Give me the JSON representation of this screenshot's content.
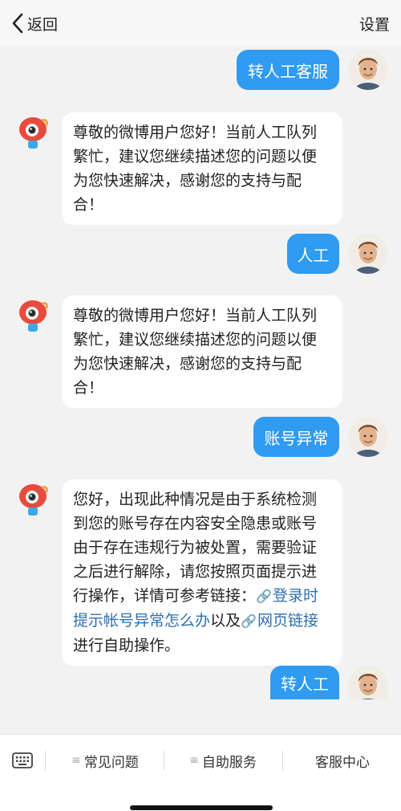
{
  "header": {
    "back_label": "返回",
    "settings_label": "设置",
    "back_icon": "chevron-left-icon"
  },
  "messages": [
    {
      "role": "user",
      "text": "转人工客服"
    },
    {
      "role": "bot",
      "text": "尊敬的微博用户您好！当前人工队列繁忙，建议您继续描述您的问题以便为您快速解决，感谢您的支持与配合！"
    },
    {
      "role": "user",
      "text": "人工"
    },
    {
      "role": "bot",
      "text": "尊敬的微博用户您好！当前人工队列繁忙，建议您继续描述您的问题以便为您快速解决，感谢您的支持与配合！"
    },
    {
      "role": "user",
      "text": "账号异常"
    },
    {
      "role": "bot",
      "text_part1": "您好，出现此种情况是由于系统检测到您的账号存在内容安全隐患或账号由于存在违规行为被处置，需要验证之后进行解除，请您按照页面提示进行操作，详情可参考链接：",
      "link1": "登录时提示帐号异常怎么办",
      "text_part2": "以及",
      "link2": "网页链接",
      "text_part3": " 进行自助操作。"
    },
    {
      "role": "user",
      "text": "转人工"
    }
  ],
  "bottom_menu": {
    "keyboard_icon": "keyboard-icon",
    "items": [
      "常见问题",
      "自助服务",
      "客服中心"
    ]
  },
  "colors": {
    "user_bubble": "#2f9bf2",
    "link": "#2d6fb0",
    "background": "#f2f2f2"
  }
}
